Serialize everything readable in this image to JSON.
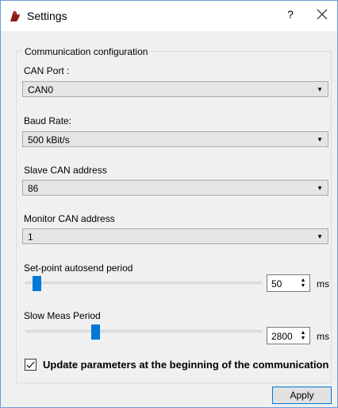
{
  "window": {
    "title": "Settings",
    "help_symbol": "?",
    "icons": {
      "app": "app-logo-icon",
      "close": "close-icon"
    }
  },
  "group": {
    "title": "Communication configuration"
  },
  "can_port": {
    "label": "CAN Port :",
    "value": "CAN0"
  },
  "baud_rate": {
    "label": "Baud Rate:",
    "value": "500 kBit/s"
  },
  "slave_address": {
    "label": "Slave CAN address",
    "value": "86"
  },
  "monitor_address": {
    "label": "Monitor CAN address",
    "value": "1"
  },
  "setpoint_period": {
    "label": "Set-point autosend period",
    "value": "50",
    "unit": "ms",
    "slider_fraction": 0.03
  },
  "slow_meas": {
    "label": "Slow Meas Period",
    "value": "2800",
    "unit": "ms",
    "slider_fraction": 0.29
  },
  "update_params": {
    "label": "Update parameters at the beginning of the communication",
    "checked": true
  },
  "apply_button": {
    "label": "Apply"
  },
  "colors": {
    "accent": "#0078d7",
    "border": "#6b9bd1"
  }
}
